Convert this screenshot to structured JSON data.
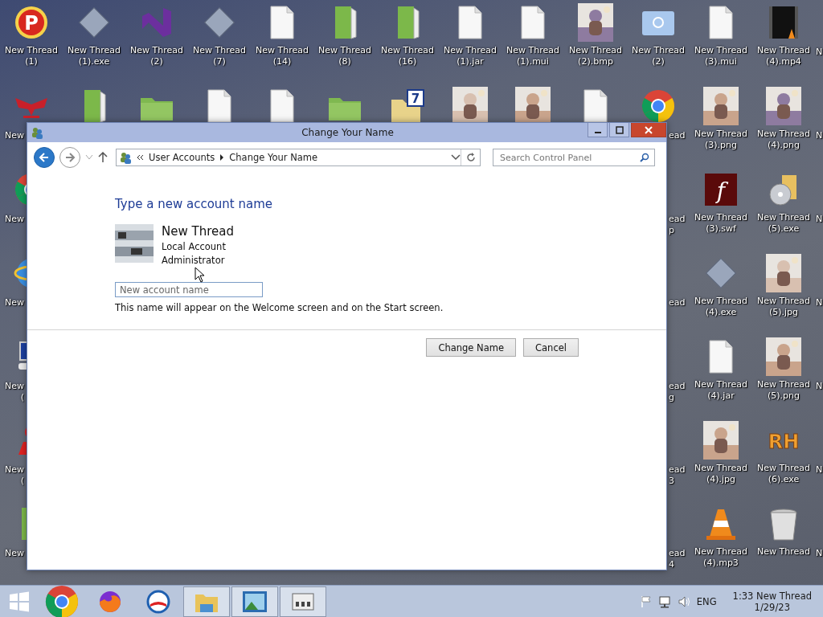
{
  "desktop": {
    "top_row": [
      {
        "kind": "badge",
        "glyph": "P",
        "label": [
          "New Thread",
          "(1)"
        ]
      },
      {
        "kind": "diamond",
        "label": [
          "New Thread",
          "(1).exe"
        ]
      },
      {
        "kind": "ribbon",
        "label": [
          "New Thread",
          "(2)"
        ]
      },
      {
        "kind": "diamond",
        "label": [
          "New Thread",
          "(7)"
        ]
      },
      {
        "kind": "file",
        "label": [
          "New Thread",
          "(14)"
        ]
      },
      {
        "kind": "book",
        "label": [
          "New Thread",
          "(8)"
        ]
      },
      {
        "kind": "book",
        "label": [
          "New Thread",
          "(16)"
        ]
      },
      {
        "kind": "file",
        "label": [
          "New Thread",
          "(1).jar"
        ]
      },
      {
        "kind": "file",
        "label": [
          "New Thread",
          "(1).mui"
        ]
      },
      {
        "kind": "picture",
        "label": [
          "New Thread",
          "(2).bmp"
        ]
      },
      {
        "kind": "bluefolder",
        "label": [
          "New Thread",
          "(2)"
        ]
      },
      {
        "kind": "file",
        "label": [
          "New Thread",
          "(3).mui"
        ]
      },
      {
        "kind": "video",
        "label": [
          "New Thread",
          "(4).mp4"
        ]
      }
    ],
    "top_row_cut": {
      "label": [
        "N"
      ]
    },
    "left_edge": [
      {
        "kind": "eagle",
        "label": [
          "New"
        ]
      },
      {
        "kind": "browser",
        "label": [
          "New"
        ]
      },
      {
        "kind": "globe",
        "label": [
          "New"
        ]
      },
      {
        "kind": "computer",
        "label": [
          "New",
          "("
        ]
      },
      {
        "kind": "figure",
        "label": [
          "New",
          "("
        ]
      },
      {
        "kind": "book",
        "label": [
          "New"
        ]
      }
    ],
    "behind_window": [
      {
        "kind": "book"
      },
      {
        "kind": "folder"
      },
      {
        "kind": "file"
      },
      {
        "kind": "file"
      },
      {
        "kind": "folder"
      },
      {
        "kind": "yellowfolder",
        "glyph": "7"
      },
      {
        "kind": "picture"
      },
      {
        "kind": "picture"
      },
      {
        "kind": "file"
      }
    ],
    "right_rows": [
      {
        "cut_left": {
          "kind": "browser",
          "label": [
            "ead"
          ]
        },
        "icons": [
          {
            "kind": "picture",
            "label": [
              "New Thread",
              "(3).png"
            ]
          },
          {
            "kind": "picture",
            "label": [
              "New Thread",
              "(4).png"
            ]
          }
        ],
        "cut_right": {
          "label": [
            "N"
          ]
        }
      },
      {
        "cut_left": {
          "label": [
            "ead",
            "p"
          ]
        },
        "icons": [
          {
            "kind": "flash",
            "glyph": "f",
            "label": [
              "New Thread",
              "(3).swf"
            ]
          },
          {
            "kind": "disc",
            "label": [
              "New Thread",
              "(5).exe"
            ]
          }
        ],
        "cut_right": {
          "label": [
            "N"
          ]
        }
      },
      {
        "cut_left": {
          "label": [
            "ead"
          ]
        },
        "icons": [
          {
            "kind": "diamond",
            "label": [
              "New Thread",
              "(4).exe"
            ]
          },
          {
            "kind": "picture",
            "label": [
              "New Thread",
              "(5).jpg"
            ]
          }
        ],
        "cut_right": {
          "label": [
            "N"
          ]
        }
      },
      {
        "cut_left": {
          "label": [
            "ead",
            "g"
          ]
        },
        "icons": [
          {
            "kind": "file",
            "label": [
              "New Thread",
              "(4).jar"
            ]
          },
          {
            "kind": "picture",
            "label": [
              "New Thread",
              "(5).png"
            ]
          }
        ],
        "cut_right": {
          "label": [
            "N"
          ]
        }
      },
      {
        "cut_left": {
          "label": [
            "ead",
            "3"
          ]
        },
        "icons": [
          {
            "kind": "picture",
            "label": [
              "New Thread",
              "(4).jpg"
            ]
          },
          {
            "kind": "wordmark",
            "glyph": "RH",
            "label": [
              "New Thread",
              "(6).exe"
            ]
          }
        ],
        "cut_right": {
          "label": [
            "N"
          ]
        }
      },
      {
        "cut_left": {
          "label": [
            "ead",
            "4"
          ]
        },
        "icons": [
          {
            "kind": "cone",
            "label": [
              "New Thread",
              "(4).mp3"
            ]
          },
          {
            "kind": "trash",
            "label": [
              "New Thread"
            ]
          }
        ],
        "cut_right": {
          "label": [
            "N"
          ]
        }
      }
    ]
  },
  "window": {
    "title": "Change Your Name",
    "breadcrumb": [
      "User Accounts",
      "Change Your Name"
    ],
    "search": {
      "placeholder": "Search Control Panel"
    },
    "heading": "Type a new account name",
    "account": {
      "name": "New Thread",
      "type": "Local Account",
      "role": "Administrator"
    },
    "name_field": {
      "placeholder": "New account name"
    },
    "note": "This name will appear on the Welcome screen and on the Start screen.",
    "buttons": [
      "Change Name",
      "Cancel"
    ]
  },
  "taskbar": {
    "pinned": [
      {
        "kind": "browser",
        "active": false
      },
      {
        "kind": "fox",
        "active": false
      },
      {
        "kind": "roundel",
        "active": false
      },
      {
        "kind": "explorer",
        "active": true
      },
      {
        "kind": "photos",
        "active": true
      },
      {
        "kind": "panel",
        "active": true
      }
    ],
    "language": "ENG",
    "time": "1:33 New Thread",
    "date": "1/29/23"
  }
}
